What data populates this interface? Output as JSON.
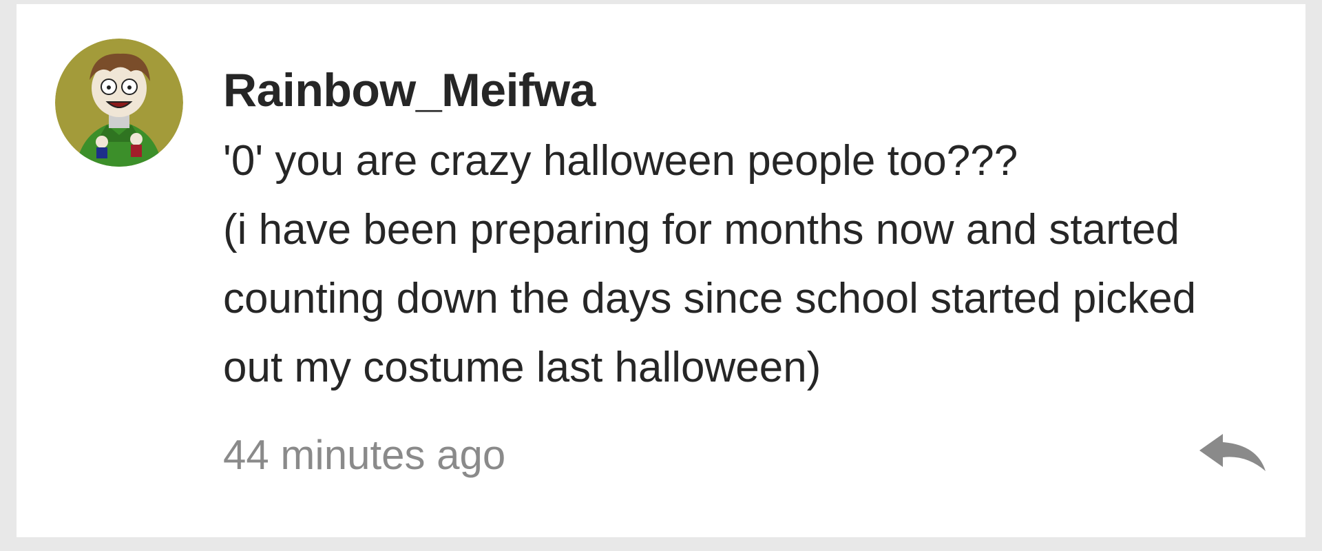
{
  "comment": {
    "author": "Rainbow_Meifwa",
    "body_lines": [
      "'0' you are crazy halloween people too???",
      "(i have been preparing for months now and started",
      "counting down the days since school started picked",
      "out my costume last halloween)"
    ],
    "timestamp": "44 minutes ago",
    "reply_icon": "reply-arrow-icon",
    "avatar_icon": "cartoon-avatar"
  },
  "colors": {
    "background": "#e8e8e8",
    "card": "#ffffff",
    "text": "#262626",
    "muted": "#8a8a8a",
    "avatar_bg": "#a39b3a",
    "hoodie": "#3c8f2a"
  }
}
